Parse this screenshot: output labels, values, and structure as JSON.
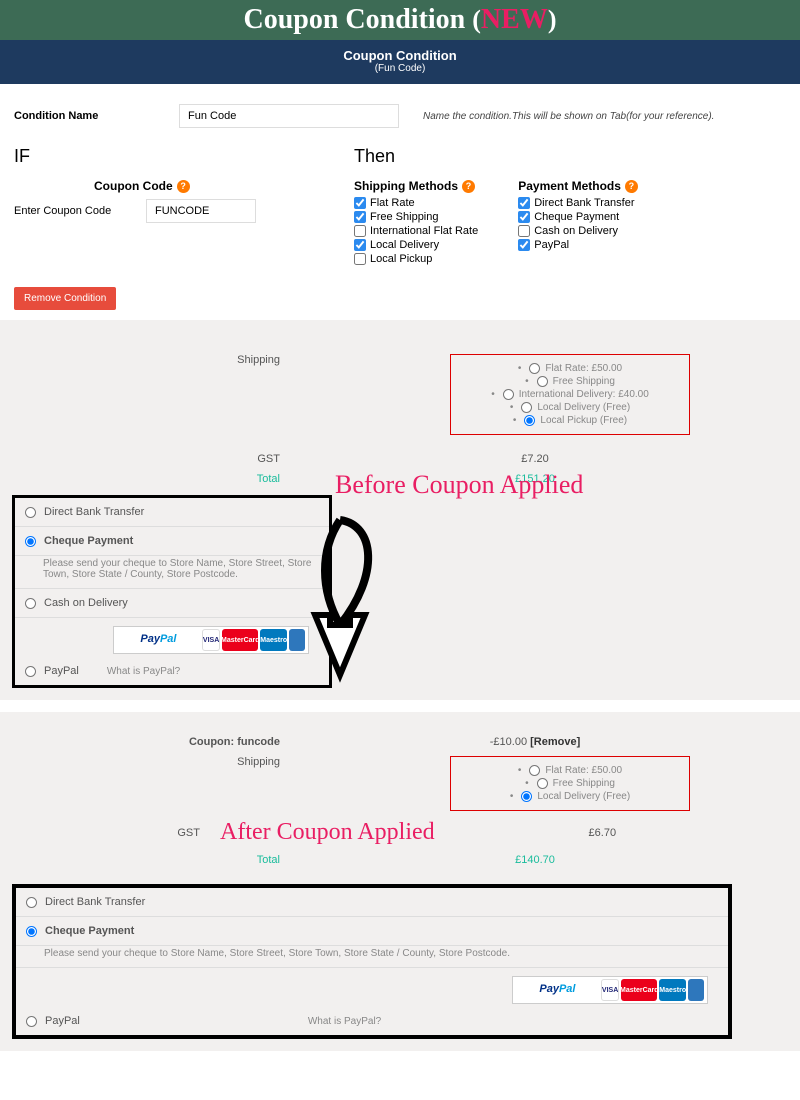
{
  "banner": {
    "title": "Coupon Condition",
    "open": "(",
    "new": "NEW",
    "close": ")"
  },
  "header": {
    "title": "Coupon Condition",
    "subtitle": "(Fun Code)"
  },
  "form": {
    "conditionNameLabel": "Condition Name",
    "conditionNameValue": "Fun Code",
    "conditionNameHint": "Name the condition.This will be shown on Tab(for your reference).",
    "ifHead": "IF",
    "thenHead": "Then",
    "couponCodeLabel": "Coupon Code",
    "enterCouponLabel": "Enter Coupon Code",
    "couponValue": "FUNCODE",
    "shippingMethodsLabel": "Shipping Methods",
    "shippingMethods": [
      {
        "label": "Flat Rate",
        "checked": true
      },
      {
        "label": "Free Shipping",
        "checked": true
      },
      {
        "label": "International Flat Rate",
        "checked": false
      },
      {
        "label": "Local Delivery",
        "checked": true
      },
      {
        "label": "Local Pickup",
        "checked": false
      }
    ],
    "paymentMethodsLabel": "Payment Methods",
    "paymentMethods": [
      {
        "label": "Direct Bank Transfer",
        "checked": true
      },
      {
        "label": "Cheque Payment",
        "checked": true
      },
      {
        "label": "Cash on Delivery",
        "checked": false
      },
      {
        "label": "PayPal",
        "checked": true
      }
    ],
    "removeBtn": "Remove Condition"
  },
  "before": {
    "callout": "Before Coupon Applied",
    "shippingLabel": "Shipping",
    "gstLabel": "GST",
    "gstValue": "£7.20",
    "totalLabel": "Total",
    "totalValue": "£151.20",
    "shipOptions": [
      {
        "label": "Flat Rate: £50.00",
        "selected": false
      },
      {
        "label": "Free Shipping",
        "selected": false
      },
      {
        "label": "International Delivery: £40.00",
        "selected": false
      },
      {
        "label": "Local Delivery (Free)",
        "selected": false
      },
      {
        "label": "Local Pickup (Free)",
        "selected": true
      }
    ],
    "payments": {
      "dbt": "Direct Bank Transfer",
      "cheque": "Cheque Payment",
      "chequeDesc": "Please send your cheque to Store Name, Store Street, Store Town, Store State / County, Store Postcode.",
      "cod": "Cash on Delivery",
      "paypal": "PayPal",
      "whatPaypal": "What is PayPal?"
    }
  },
  "after": {
    "callout": "After Coupon Applied",
    "couponLabel": "Coupon: funcode",
    "couponValue": "-£10.00",
    "removeLink": "[Remove]",
    "shippingLabel": "Shipping",
    "gstLabel": "GST",
    "gstValue": "£6.70",
    "totalLabel": "Total",
    "totalValue": "£140.70",
    "shipOptions": [
      {
        "label": "Flat Rate: £50.00",
        "selected": false
      },
      {
        "label": "Free Shipping",
        "selected": false
      },
      {
        "label": "Local Delivery (Free)",
        "selected": true
      }
    ],
    "payments": {
      "dbt": "Direct Bank Transfer",
      "cheque": "Cheque Payment",
      "chequeDesc": "Please send your cheque to Store Name, Store Street, Store Town, Store State / County, Store Postcode.",
      "paypal": "PayPal",
      "whatPaypal": "What is PayPal?"
    }
  },
  "cards": {
    "visa": "VISA",
    "mc": "MasterCard",
    "maestro": "Maestro",
    "amex": ""
  }
}
